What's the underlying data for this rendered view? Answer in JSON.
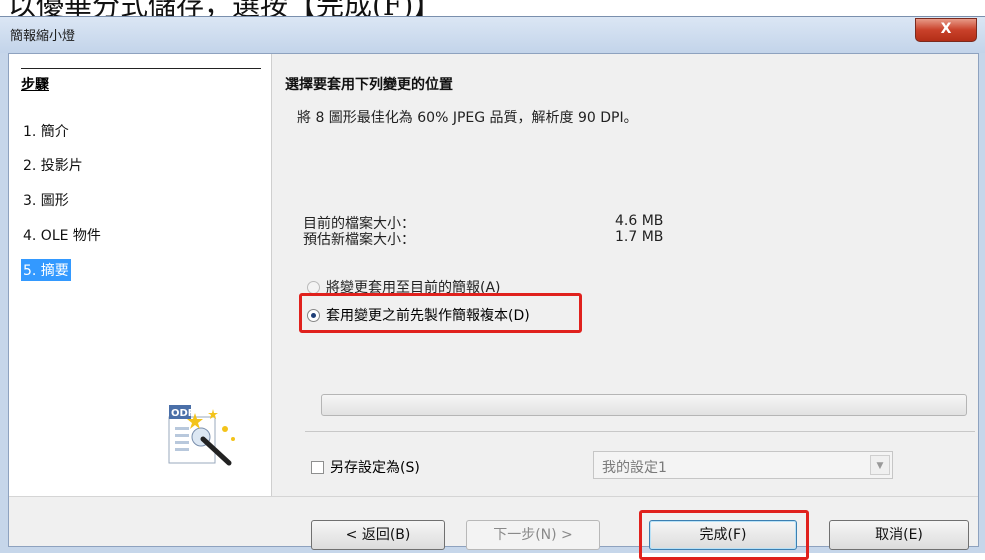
{
  "top_caption": "以優華分式儲存，選按【完成(F)】",
  "window": {
    "title": "簡報縮小燈",
    "close_label": "X"
  },
  "steps": {
    "title": "步驟",
    "items": [
      "1. 簡介",
      "2. 投影片",
      "3. 圖形",
      "4. OLE 物件",
      "5. 摘要"
    ],
    "current_index": 4
  },
  "summary": {
    "heading": "選擇要套用下列變更的位置",
    "description": "將 8 圖形最佳化為 60% JPEG 品質，解析度 90 DPI。",
    "current_size_label": "目前的檔案大小：",
    "current_size_value": "4.6 MB",
    "new_size_label": "預估新檔案大小：",
    "new_size_value": "1.7 MB",
    "option_apply_current": "將變更套用至目前的簡報(A)",
    "option_copy_first": "套用變更之前先製作簡報複本(D)",
    "selected_option": "option_copy_first",
    "progress_fraction": 0
  },
  "save_settings": {
    "checkbox_label": "另存設定為(S)",
    "checked": false,
    "combo_value": "我的設定1"
  },
  "buttons": {
    "back": "< 返回(B)",
    "next": "下一步(N) >",
    "finish": "完成(F)",
    "cancel": "取消(E)"
  },
  "icon": "odf-wand-icon",
  "colors": {
    "highlight": "#e0211d",
    "selection": "#3399ff"
  }
}
